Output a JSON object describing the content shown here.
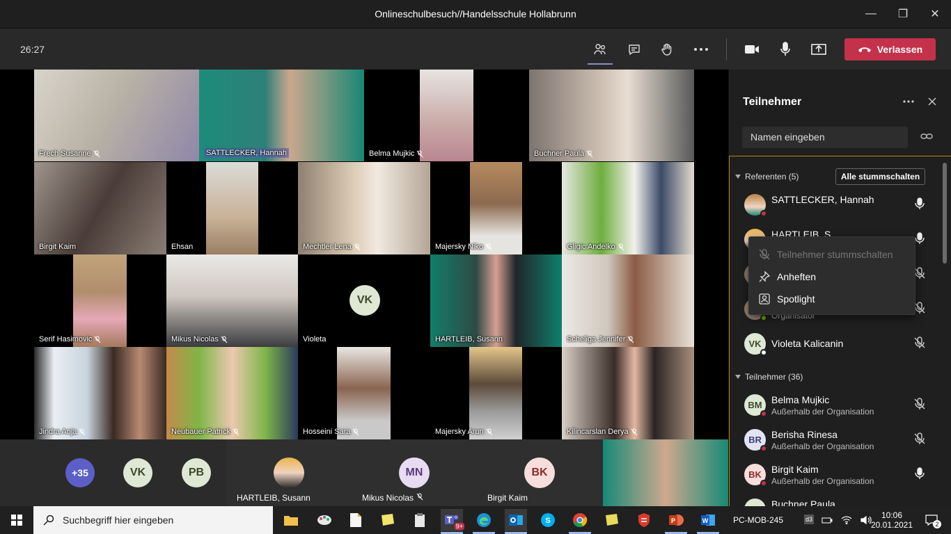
{
  "window": {
    "title": "Onlineschulbesuch//Handelsschule Hollabrunn",
    "minimize": "—",
    "maximize": "❐",
    "close": "✕"
  },
  "toolbar": {
    "timer": "26:27",
    "leave_label": "Verlassen"
  },
  "colors": {
    "leave": "#c4314b",
    "accent": "#8b8cc7",
    "avatar_green": "#dfe8d4",
    "avatar_purple": "#e8dcf2",
    "avatar_pink": "#f6dedd"
  },
  "tiles": [
    {
      "name": "Frech Susanne"
    },
    {
      "name": "SATTLECKER, Hannah"
    },
    {
      "name": "Belma Mujkic"
    },
    {
      "name": "Buchner Paula"
    },
    {
      "name": "Birgit Kaim"
    },
    {
      "name": "Ehsan"
    },
    {
      "name": "Mechtler Lena"
    },
    {
      "name": "Majersky Niko"
    },
    {
      "name": "Gligic Andelko"
    },
    {
      "name": "Serif Hasimovic"
    },
    {
      "name": "Mikus Nicolas"
    },
    {
      "name": "Violeta",
      "initials": "VK"
    },
    {
      "name": "HARTLEIB, Susann"
    },
    {
      "name": "Scheliga Jennifer"
    },
    {
      "name": "Jindra Anja"
    },
    {
      "name": "Neubauer Patrick"
    },
    {
      "name": "Hosseini Sara"
    },
    {
      "name": "Majersky Arun"
    },
    {
      "name": "Kilincarslan Derya"
    }
  ],
  "strip": {
    "more": "+35",
    "vk": "VK",
    "pb": "PB",
    "hartleib": "HARTLEIB, Susann",
    "mn_initials": "MN",
    "mn_name": "Mikus Nicolas",
    "bk_initials": "BK",
    "bk_name": "Birgit Kaim"
  },
  "panel": {
    "title": "Teilnehmer",
    "search_placeholder": "Namen eingeben",
    "presenters_label": "Referenten (5)",
    "mute_all": "Alle stummschalten",
    "participants_label": "Teilnehmer (36)",
    "presenters": [
      {
        "name": "SATTLECKER, Hannah"
      },
      {
        "name": "HARTLEIB, S..."
      },
      {
        "name": ""
      },
      {
        "name": "",
        "sub": "Organisator"
      },
      {
        "name": "Violeta Kalicanin",
        "initials": "VK"
      }
    ],
    "participants": [
      {
        "name": "Belma Mujkic",
        "initials": "BM",
        "sub": "Außerhalb der Organisation"
      },
      {
        "name": "Berisha Rinesa",
        "initials": "BR",
        "sub": "Außerhalb der Organisation"
      },
      {
        "name": "Birgit Kaim",
        "initials": "BK",
        "sub": "Außerhalb der Organisation"
      },
      {
        "name": "Buchner Paula",
        "initials": "BP"
      }
    ]
  },
  "context_menu": {
    "mute": "Teilnehmer stummschalten",
    "pin": "Anheften",
    "spotlight": "Spotlight"
  },
  "taskbar": {
    "search_placeholder": "Suchbegriff hier eingeben",
    "teams_badge": "9+",
    "computer_name": "PC-MOB-245",
    "lang": "d3",
    "time": "10:06",
    "date": "20.01.2021",
    "notifications": "2"
  }
}
